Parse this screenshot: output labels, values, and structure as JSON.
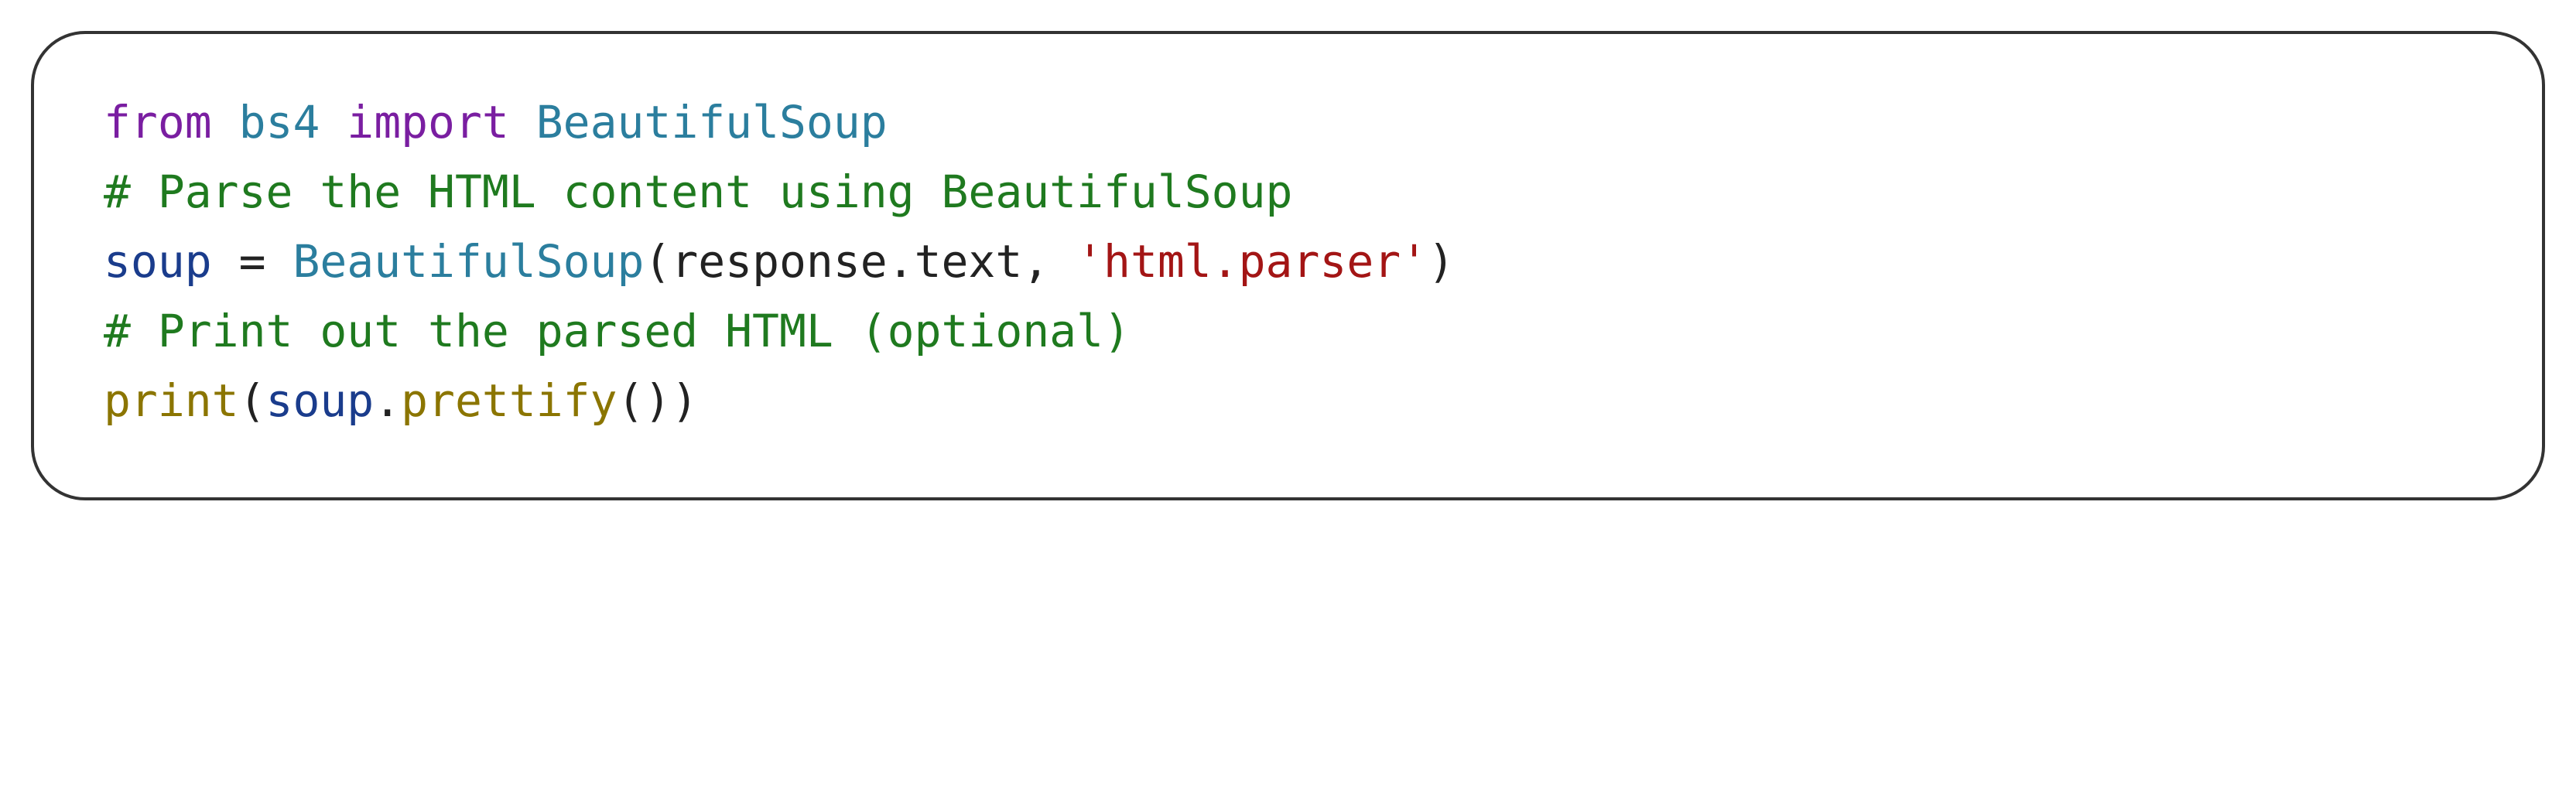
{
  "code": {
    "line1": {
      "kw_from": "from",
      "module": "bs4",
      "kw_import": "import",
      "cls": "BeautifulSoup"
    },
    "line2": {
      "comment": "# Parse the HTML content using BeautifulSoup"
    },
    "line3": {
      "var": "soup",
      "eq": " = ",
      "cls": "BeautifulSoup",
      "open": "(",
      "arg1": "response.text",
      "comma": ", ",
      "str": "'html.parser'",
      "close": ")"
    },
    "line4": {
      "comment": "# Print out the parsed HTML (optional)"
    },
    "line5": {
      "builtin": "print",
      "open": "(",
      "var": "soup",
      "dot": ".",
      "method": "prettify",
      "call": "()",
      "close": ")"
    }
  }
}
